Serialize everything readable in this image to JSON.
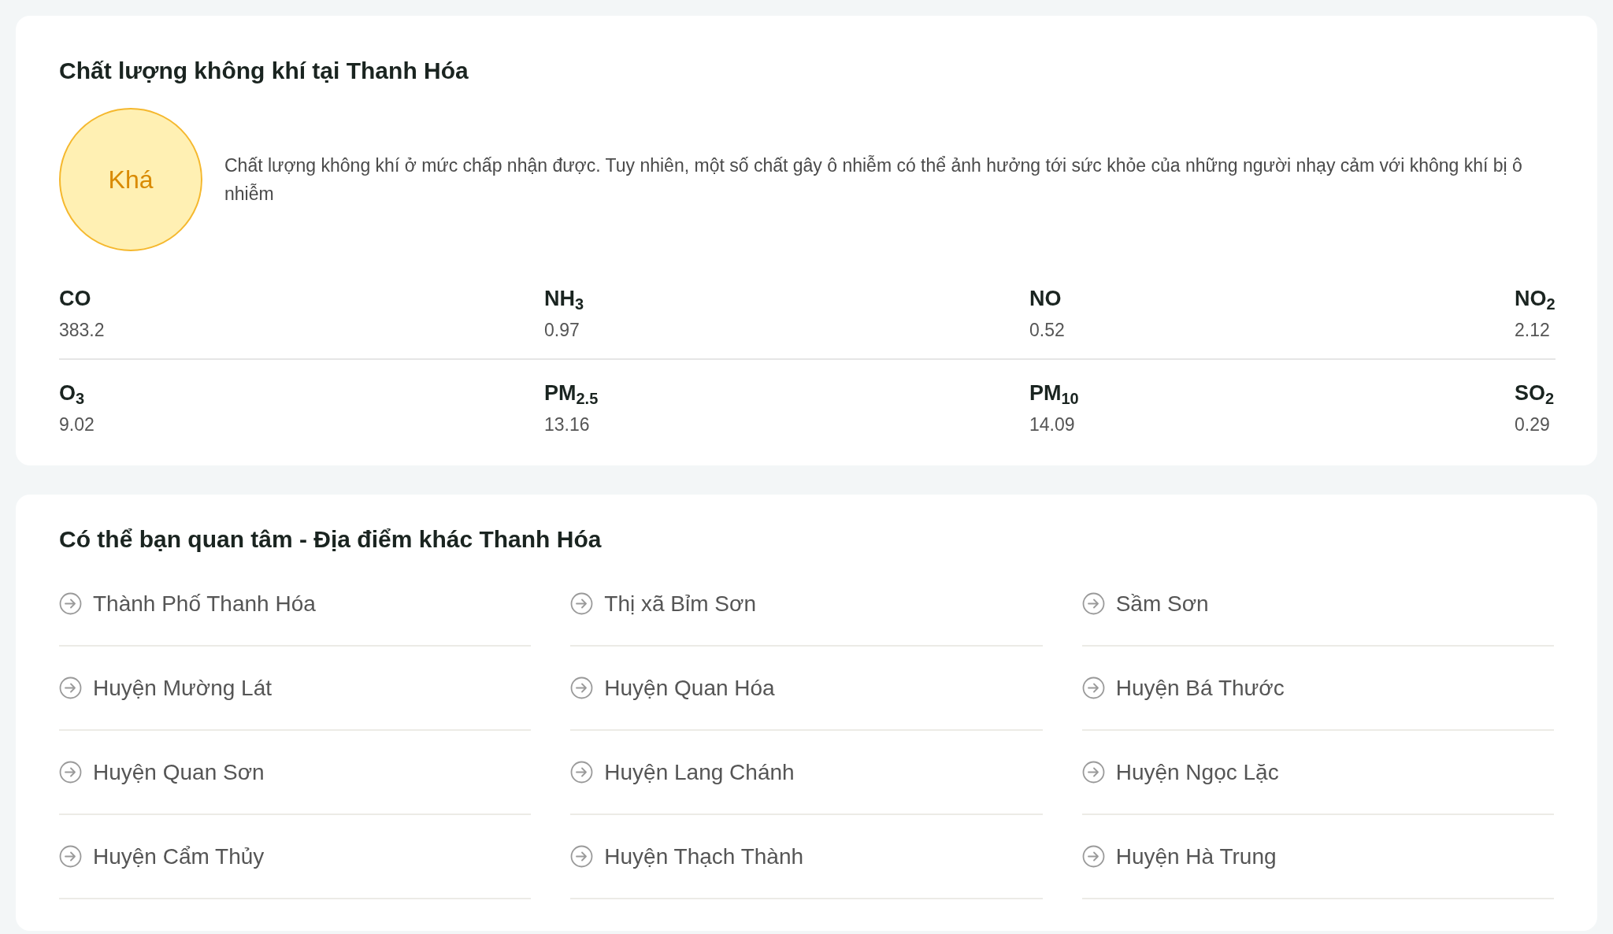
{
  "air_quality": {
    "title": "Chất lượng không khí tại Thanh Hóa",
    "rating": "Khá",
    "description": "Chất lượng không khí ở mức chấp nhận được. Tuy nhiên, một số chất gây ô nhiễm có thể ảnh hưởng tới sức khỏe của những người nhạy cảm với không khí bị ô nhiễm",
    "pollutants": [
      {
        "name": "CO",
        "value": "383.2"
      },
      {
        "name": "NH$_{3}$",
        "value": "0.97"
      },
      {
        "name": "NO",
        "value": "0.52"
      },
      {
        "name": "NO$_{2}$",
        "value": "2.12"
      },
      {
        "name": "O$_{3}$",
        "value": "9.02"
      },
      {
        "name": "PM$_{2.5}$",
        "value": "13.16"
      },
      {
        "name": "PM$_{10}$",
        "value": "14.09"
      },
      {
        "name": "SO$_{2}$",
        "value": "0.29"
      }
    ]
  },
  "other_places": {
    "title": "Có thể bạn quan tâm - Địa điểm khác Thanh Hóa",
    "items": [
      "Thành Phố Thanh Hóa",
      "Thị xã Bỉm Sơn",
      "Sầm Sơn",
      "Huyện Mường Lát",
      "Huyện Quan Hóa",
      "Huyện Bá Thước",
      "Huyện Quan Sơn",
      "Huyện Lang Chánh",
      "Huyện Ngọc Lặc",
      "Huyện Cẩm Thủy",
      "Huyện Thạch Thành",
      "Huyện Hà Trung"
    ]
  }
}
